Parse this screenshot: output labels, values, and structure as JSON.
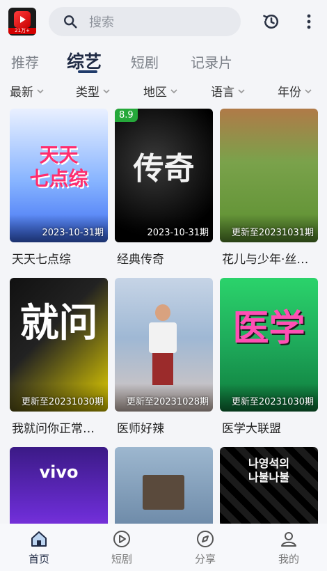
{
  "app": {
    "logo_text": "21万+",
    "search_placeholder": "搜索"
  },
  "tabs": [
    {
      "label": "推荐",
      "active": false
    },
    {
      "label": "综艺",
      "active": true
    },
    {
      "label": "短剧",
      "active": false
    },
    {
      "label": "记录片",
      "active": false
    }
  ],
  "filters": [
    {
      "label": "最新"
    },
    {
      "label": "类型"
    },
    {
      "label": "地区"
    },
    {
      "label": "语言"
    },
    {
      "label": "年份"
    }
  ],
  "cards": [
    {
      "title": "天天七点综",
      "badge": "2023-10-31期",
      "rating": "",
      "poster_text": "天天\n七点综"
    },
    {
      "title": "经典传奇",
      "badge": "2023-10-31期",
      "rating": "8.9",
      "poster_text": "传奇"
    },
    {
      "title": "花儿与少年·丝…",
      "badge": "更新至20231031期",
      "rating": "",
      "poster_text": ""
    },
    {
      "title": "我就问你正常…",
      "badge": "更新至20231030期",
      "rating": "",
      "poster_text": "就问"
    },
    {
      "title": "医师好辣",
      "badge": "更新至20231028期",
      "rating": "",
      "poster_text": ""
    },
    {
      "title": "医学大联盟",
      "badge": "更新至20231030期",
      "rating": "",
      "poster_text": "医学"
    },
    {
      "title": "",
      "badge": "",
      "rating": "",
      "poster_text": "vivo"
    },
    {
      "title": "",
      "badge": "",
      "rating": "",
      "poster_text": ""
    },
    {
      "title": "",
      "badge": "",
      "rating": "",
      "poster_text": "나영석의\n나불나불"
    }
  ],
  "bottom_nav": [
    {
      "label": "首页",
      "icon": "home-icon",
      "active": true
    },
    {
      "label": "短剧",
      "icon": "play-circle-icon",
      "active": false
    },
    {
      "label": "分享",
      "icon": "compass-icon",
      "active": false
    },
    {
      "label": "我的",
      "icon": "user-icon",
      "active": false
    }
  ],
  "colors": {
    "accent": "#1f2a44",
    "rating_green": "#25a83a",
    "brand_red": "#d40000"
  }
}
